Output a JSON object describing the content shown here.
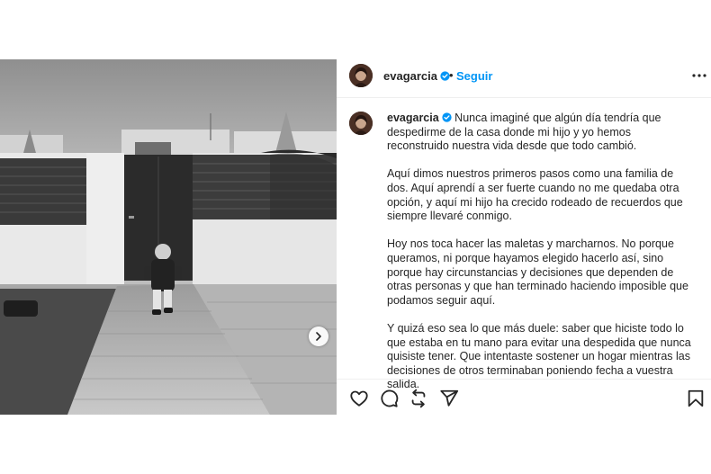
{
  "post": {
    "username": "evagarcia",
    "separator": "•",
    "follow_label": "Seguir",
    "caption_paragraphs": [
      "Nunca imaginé que algún día tendría que despedirme de la casa donde mi hijo y yo hemos reconstruido nuestra vida desde que todo cambió.",
      "Aquí dimos nuestros primeros pasos como una familia de dos. Aquí aprendí a ser fuerte cuando no me quedaba otra opción, y aquí mi hijo ha crecido rodeado de recuerdos que siempre llevaré conmigo.",
      "Hoy nos toca hacer las maletas y marcharnos. No porque queramos, ni porque hayamos elegido hacerlo así, sino porque hay circunstancias y decisiones que dependen de otras personas y que han terminado haciendo imposible que podamos seguir aquí.",
      "Y quizá eso sea lo que más duele: saber que hiciste todo lo que estaba en tu mano para evitar una despedida que nunca quisiste tener. Que intentaste sostener un hogar mientras las decisiones de otros terminaban poniendo fecha a vuestra salida."
    ]
  },
  "icons": {
    "verified": "verified-badge-icon",
    "more": "more-options-icon",
    "next": "chevron-right-icon",
    "like": "heart-icon",
    "comment": "comment-icon",
    "share": "repost-icon",
    "send": "send-icon",
    "save": "bookmark-icon"
  },
  "colors": {
    "follow_blue": "#0095f6",
    "verified_blue": "#0095f6",
    "text": "#262626",
    "divider": "#efefef"
  }
}
